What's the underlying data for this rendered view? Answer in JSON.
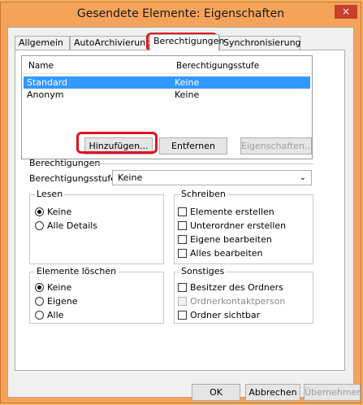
{
  "dialog": {
    "title": "Gesendete Elemente: Eigenschaften",
    "close_symbol": "×"
  },
  "tabs": [
    {
      "label": "Allgemein"
    },
    {
      "label": "AutoArchivierung"
    },
    {
      "label": "Berechtigungen",
      "active": true
    },
    {
      "label": "Synchronisierung"
    }
  ],
  "list": {
    "columns": [
      "Name",
      "Berechtigungsstufe"
    ],
    "rows": [
      {
        "name": "Standard",
        "level": "Keine",
        "selected": true
      },
      {
        "name": "Anonym",
        "level": "Keine",
        "selected": false
      }
    ]
  },
  "list_buttons": {
    "add": "Hinzufügen...",
    "remove": "Entfernen",
    "properties": "Eigenschaften..."
  },
  "permissions": {
    "section_label": "Berechtigungen",
    "level_label": "Berechtigungsstufe:",
    "level_value": "Keine",
    "read": {
      "label": "Lesen",
      "options": [
        {
          "label": "Keine",
          "checked": true
        },
        {
          "label": "Alle Details",
          "checked": false
        }
      ]
    },
    "write": {
      "label": "Schreiben",
      "options": [
        {
          "label": "Elemente erstellen"
        },
        {
          "label": "Unterordner erstellen"
        },
        {
          "label": "Eigene bearbeiten"
        },
        {
          "label": "Alles bearbeiten"
        }
      ]
    },
    "delete": {
      "label": "Elemente löschen",
      "options": [
        {
          "label": "Keine",
          "checked": true
        },
        {
          "label": "Eigene",
          "checked": false
        },
        {
          "label": "Alle",
          "checked": false
        }
      ]
    },
    "other": {
      "label": "Sonstiges",
      "options": [
        {
          "label": "Besitzer des Ordners",
          "disabled": false
        },
        {
          "label": "Ordnerkontaktperson",
          "disabled": true
        },
        {
          "label": "Ordner sichtbar",
          "disabled": false
        }
      ]
    }
  },
  "footer": {
    "ok": "OK",
    "cancel": "Abbrechen",
    "apply": "Übernehmen"
  },
  "colors": {
    "title_bar": "#f5a35b",
    "selection": "#3399ff",
    "highlight": "#e0141d",
    "close_button": "#c7402b"
  }
}
